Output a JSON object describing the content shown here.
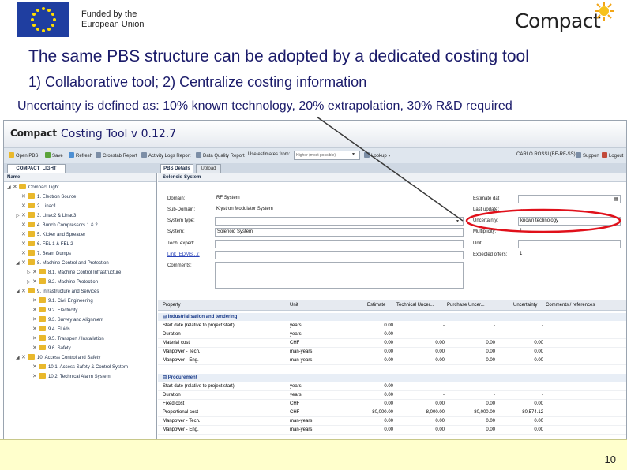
{
  "header": {
    "funded_line1": "Funded by the",
    "funded_line2": "European Union",
    "logo_text": "Compact"
  },
  "slide": {
    "title": "The same PBS structure can be adopted by a dedicated costing tool",
    "subtitle": "1) Collaborative tool; 2) Centralize costing information",
    "note": "Uncertainty is defined as: 10% known technology, 20% extrapolation, 30% R&D required",
    "page_number": "10"
  },
  "app": {
    "logo": "Compact",
    "title": "Costing Tool v 0.12.7",
    "toolbar": {
      "open": "Open PBS",
      "save": "Save",
      "refresh": "Refresh",
      "crosstab": "Crosstab Report",
      "activity": "Activity Logs Report",
      "dataquality": "Data Quality Report",
      "use_estimates": "Use estimates from:",
      "estimates_value": "Higher (most possible)",
      "lookup": "Lookup",
      "user": "CARLO ROSSI (BE-RF-SS)",
      "support": "Support",
      "logout": "Logout"
    },
    "left_tab": "COMPACT_LIGHT",
    "right_tabs": [
      "PBS Details",
      "Upload"
    ],
    "tree": {
      "header": "Name",
      "items": [
        {
          "label": "Compact Light"
        },
        {
          "label": "1. Electron Source"
        },
        {
          "label": "2. Linac1"
        },
        {
          "label": "3. Linac2 & Linac3"
        },
        {
          "label": "4. Bunch Compressors 1 & 2"
        },
        {
          "label": "5. Kicker and Spreader"
        },
        {
          "label": "6. FEL 1 & FEL 2"
        },
        {
          "label": "7. Beam Dumps"
        },
        {
          "label": "8. Machine Control and Protection"
        },
        {
          "label": "8.1. Machine Control Infrastructure"
        },
        {
          "label": "8.2. Machine Protection"
        },
        {
          "label": "9. Infrastructure and Services"
        },
        {
          "label": "9.1. Civil Engineering"
        },
        {
          "label": "9.2. Electricity"
        },
        {
          "label": "9.3. Survey and Alignment"
        },
        {
          "label": "9.4. Fluids"
        },
        {
          "label": "9.5. Transport / Installation"
        },
        {
          "label": "9.6. Safety"
        },
        {
          "label": "10. Access Control and Safety"
        },
        {
          "label": "10.1. Access Safety & Control System"
        },
        {
          "label": "10.2. Technical Alarm System"
        }
      ]
    },
    "details": {
      "pane_title": "Solenoid System",
      "domain_label": "Domain:",
      "domain_value": "RF System",
      "subdomain_label": "Sub-Domain:",
      "subdomain_value": "Klystron Modulator System",
      "systemtype_label": "System type:",
      "systemtype_value": "",
      "system_label": "System:",
      "system_value": "Solenoid System",
      "techexpert_label": "Tech. expert:",
      "techexpert_value": "",
      "link_label": "Link (EDMS...):",
      "link_value": "",
      "comments_label": "Comments:",
      "estimate_date_label": "Estimate dat",
      "estimate_date_value": "",
      "last_update_label": "Last update:",
      "last_update_value": "...",
      "uncertainty_label": "Uncertainty:",
      "uncertainty_value": "known technology",
      "multiplicity_label": "Multiplicity:",
      "multiplicity_value": "1",
      "unit_label": "Unit:",
      "unit_value": "",
      "expected_offers_label": "Expected offers:",
      "expected_offers_value": "1"
    },
    "grid": {
      "columns": [
        "Property",
        "Unit",
        "Estimate",
        "Technical Uncer...",
        "Purchase Uncer...",
        "Uncertainty",
        "Comments / references"
      ],
      "sections": [
        {
          "title": "Industrialisation and tendering",
          "rows": [
            [
              "Start date (relative to project start)",
              "years",
              "0.00",
              "-",
              "-",
              "-"
            ],
            [
              "Duration",
              "years",
              "0.00",
              "-",
              "-",
              "-"
            ],
            [
              "Material cost",
              "CHF",
              "0.00",
              "0.00",
              "0.00",
              "0.00"
            ],
            [
              "Manpower - Tech.",
              "man-years",
              "0.00",
              "0.00",
              "0.00",
              "0.00"
            ],
            [
              "Manpower - Eng.",
              "man-years",
              "0.00",
              "0.00",
              "0.00",
              "0.00"
            ]
          ]
        },
        {
          "title": "Procurement",
          "rows": [
            [
              "Start date (relative to project start)",
              "years",
              "0.00",
              "-",
              "-",
              "-"
            ],
            [
              "Duration",
              "years",
              "0.00",
              "-",
              "-",
              "-"
            ],
            [
              "Fixed cost",
              "CHF",
              "0.00",
              "0.00",
              "0.00",
              "0.00"
            ],
            [
              "Proportional cost",
              "CHF",
              "80,000.00",
              "8,000.00",
              "80,000.00",
              "80,574.12"
            ],
            [
              "Manpower - Tech.",
              "man-years",
              "0.00",
              "0.00",
              "0.00",
              "0.00"
            ],
            [
              "Manpower - Eng.",
              "man-years",
              "0.00",
              "0.00",
              "0.00",
              "0.00"
            ]
          ]
        }
      ]
    }
  },
  "colors": {
    "heading": "#1b1b6a",
    "highlight_ellipse": "#e0101a",
    "footer_bg": "#ffffcc",
    "eu_blue": "#1f3ea0",
    "eu_star": "#ffdd00"
  }
}
